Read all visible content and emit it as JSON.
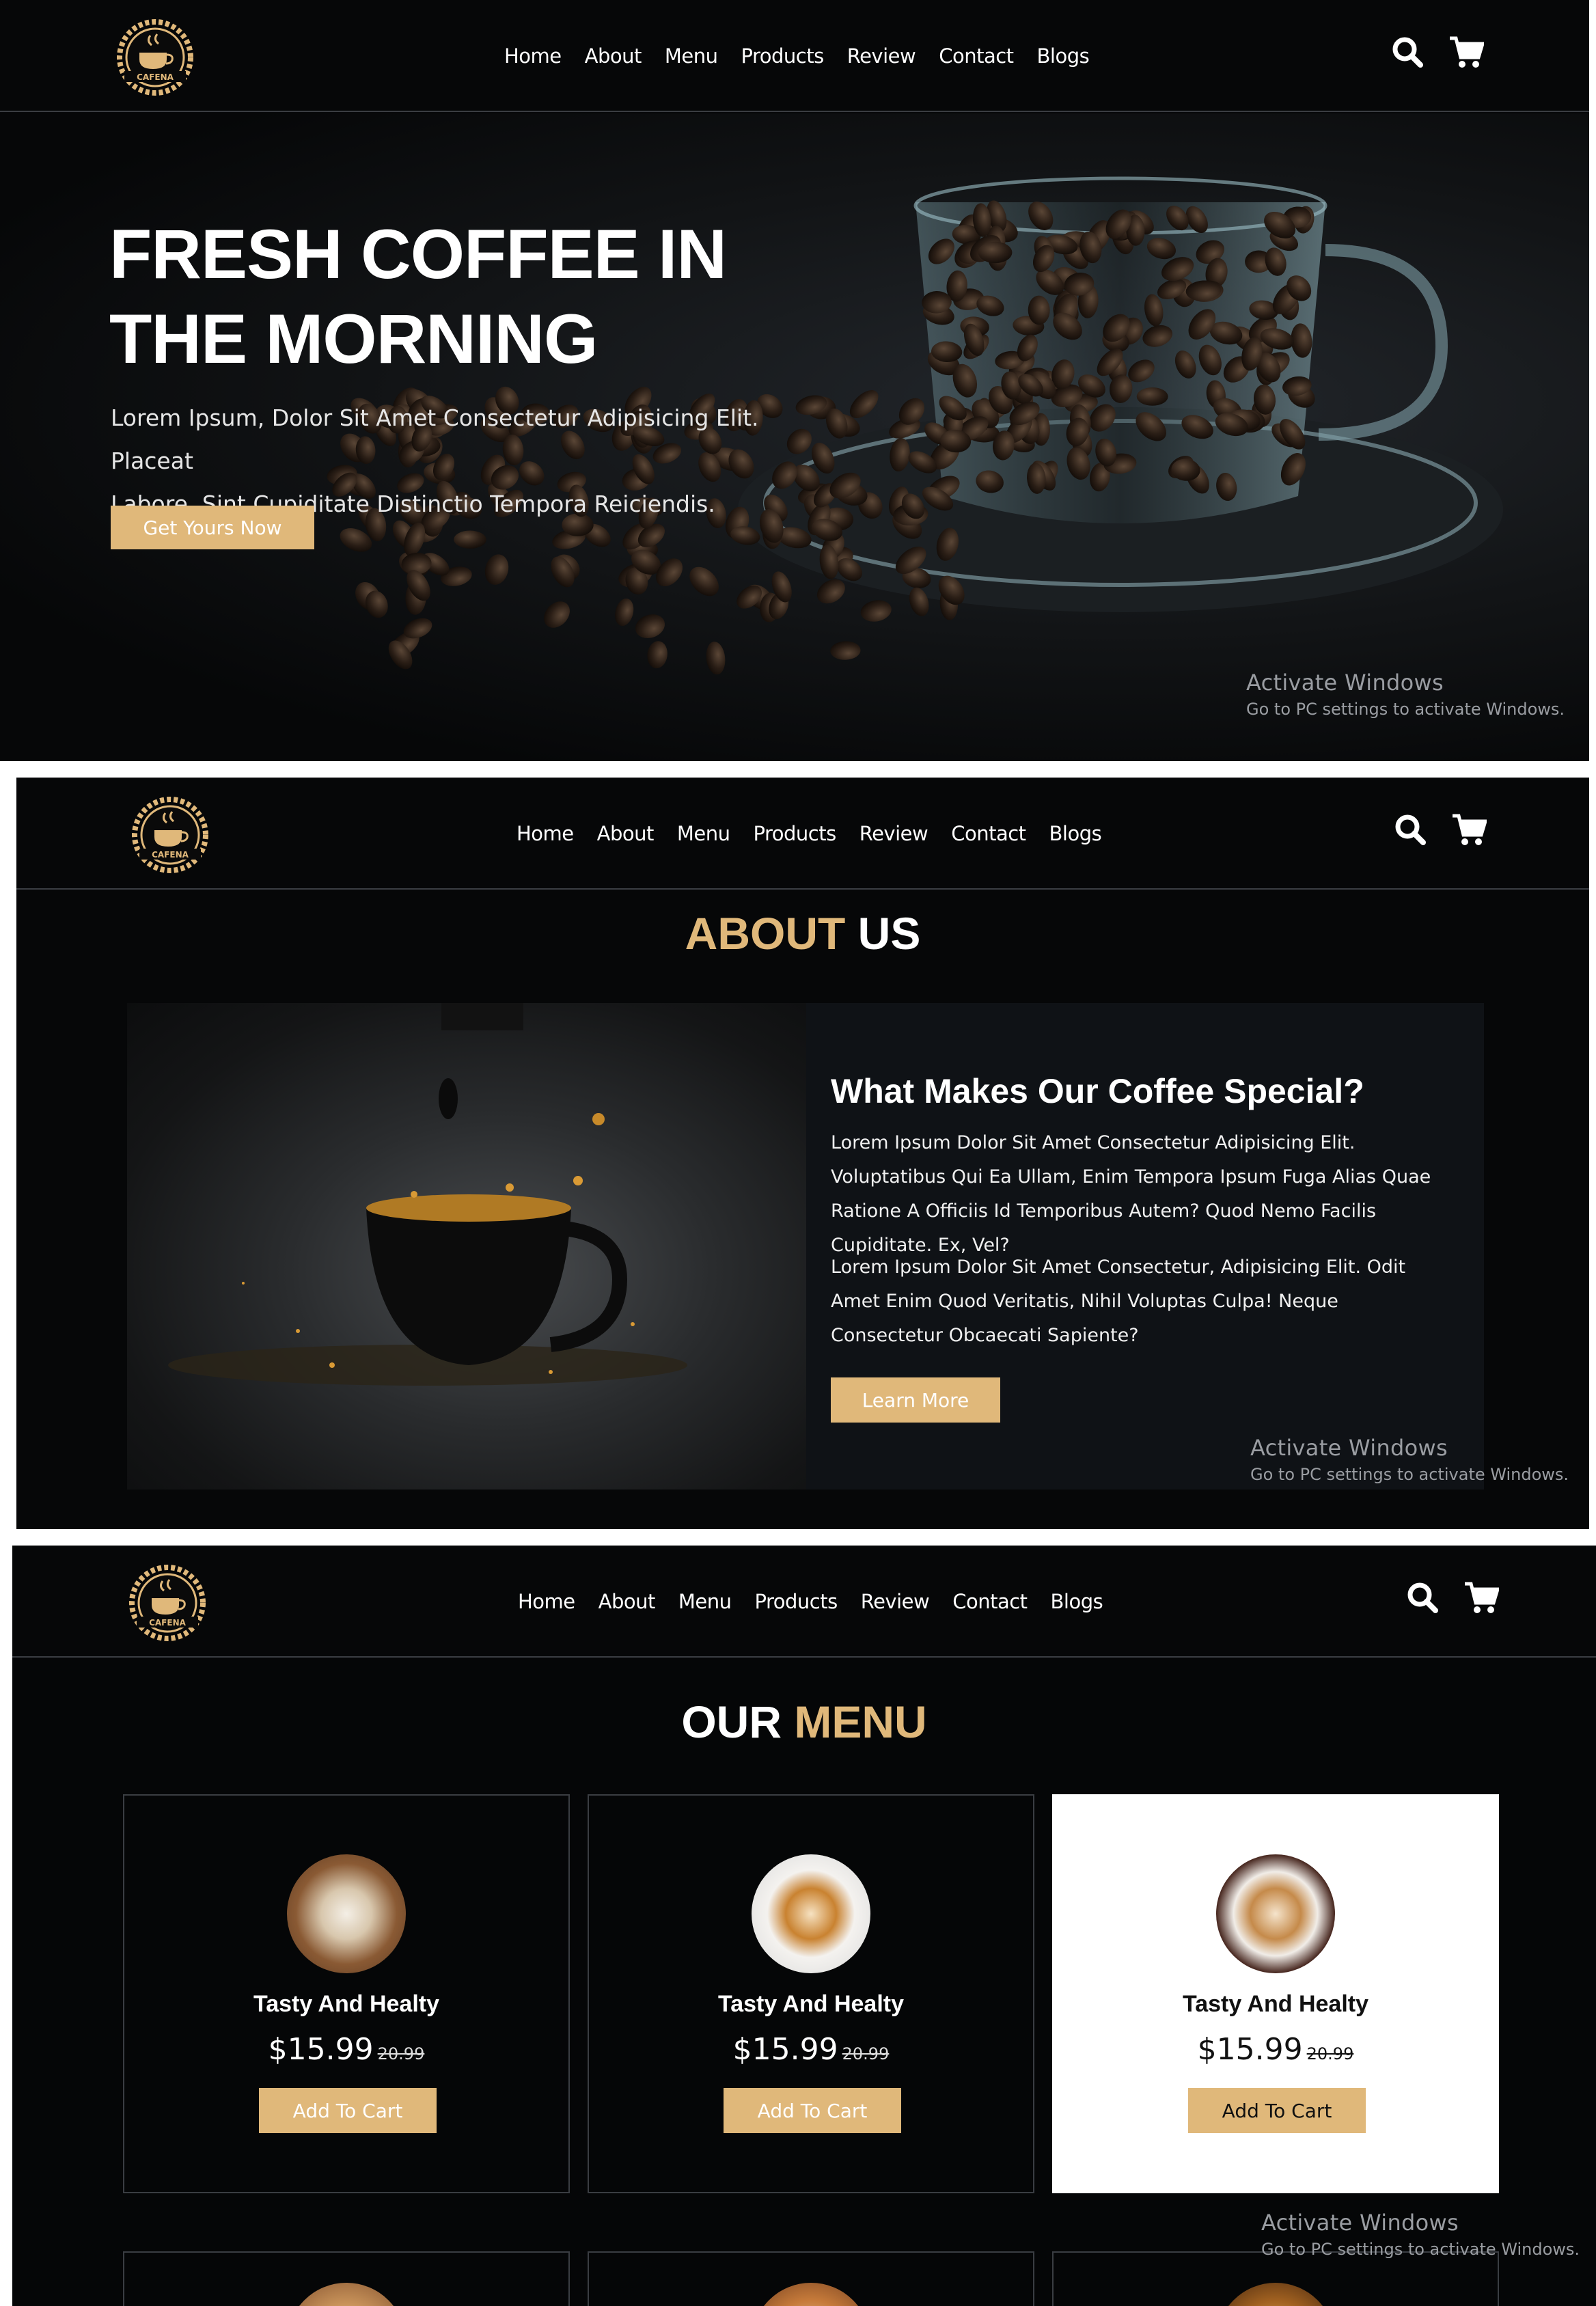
{
  "nav": {
    "brand": "CAFENA",
    "links": [
      "Home",
      "About",
      "Menu",
      "Products",
      "Review",
      "Contact",
      "Blogs"
    ]
  },
  "hero": {
    "title_line1": "FRESH COFFEE IN",
    "title_line2": "THE MORNING",
    "text_line1": "Lorem Ipsum, Dolor Sit Amet Consectetur Adipisicing Elit. Placeat",
    "text_line2": "Labore, Sint Cupiditate Distinctio Tempora Reiciendis.",
    "button": "Get Yours Now"
  },
  "about": {
    "title_accent": "ABOUT",
    "title_rest": "US",
    "heading": "What Makes Our Coffee Special?",
    "para1": "Lorem Ipsum Dolor Sit Amet Consectetur Adipisicing Elit. Voluptatibus Qui Ea Ullam, Enim Tempora Ipsum Fuga Alias Quae Ratione A Officiis Id Temporibus Autem? Quod Nemo Facilis Cupiditate. Ex, Vel?",
    "para2": "Lorem Ipsum Dolor Sit Amet Consectetur, Adipisicing Elit. Odit Amet Enim Quod Veritatis, Nihil Voluptas Culpa! Neque Consectetur Obcaecati Sapiente?",
    "button": "Learn More"
  },
  "menu": {
    "title_rest": "OUR",
    "title_accent": "MENU",
    "items": [
      {
        "name": "Tasty And Healty",
        "price": "$15.99",
        "old_price": "20.99",
        "button": "Add To Cart"
      },
      {
        "name": "Tasty And Healty",
        "price": "$15.99",
        "old_price": "20.99",
        "button": "Add To Cart"
      },
      {
        "name": "Tasty And Healty",
        "price": "$15.99",
        "old_price": "20.99",
        "button": "Add To Cart"
      }
    ]
  },
  "watermark": {
    "title": "Activate Windows",
    "subtitle": "Go to PC settings to activate Windows."
  },
  "colors": {
    "accent": "#e0b87a",
    "background": "#070809",
    "panel": "#0f1216"
  },
  "icons": [
    "logo-badge-icon",
    "search-icon",
    "cart-icon"
  ]
}
